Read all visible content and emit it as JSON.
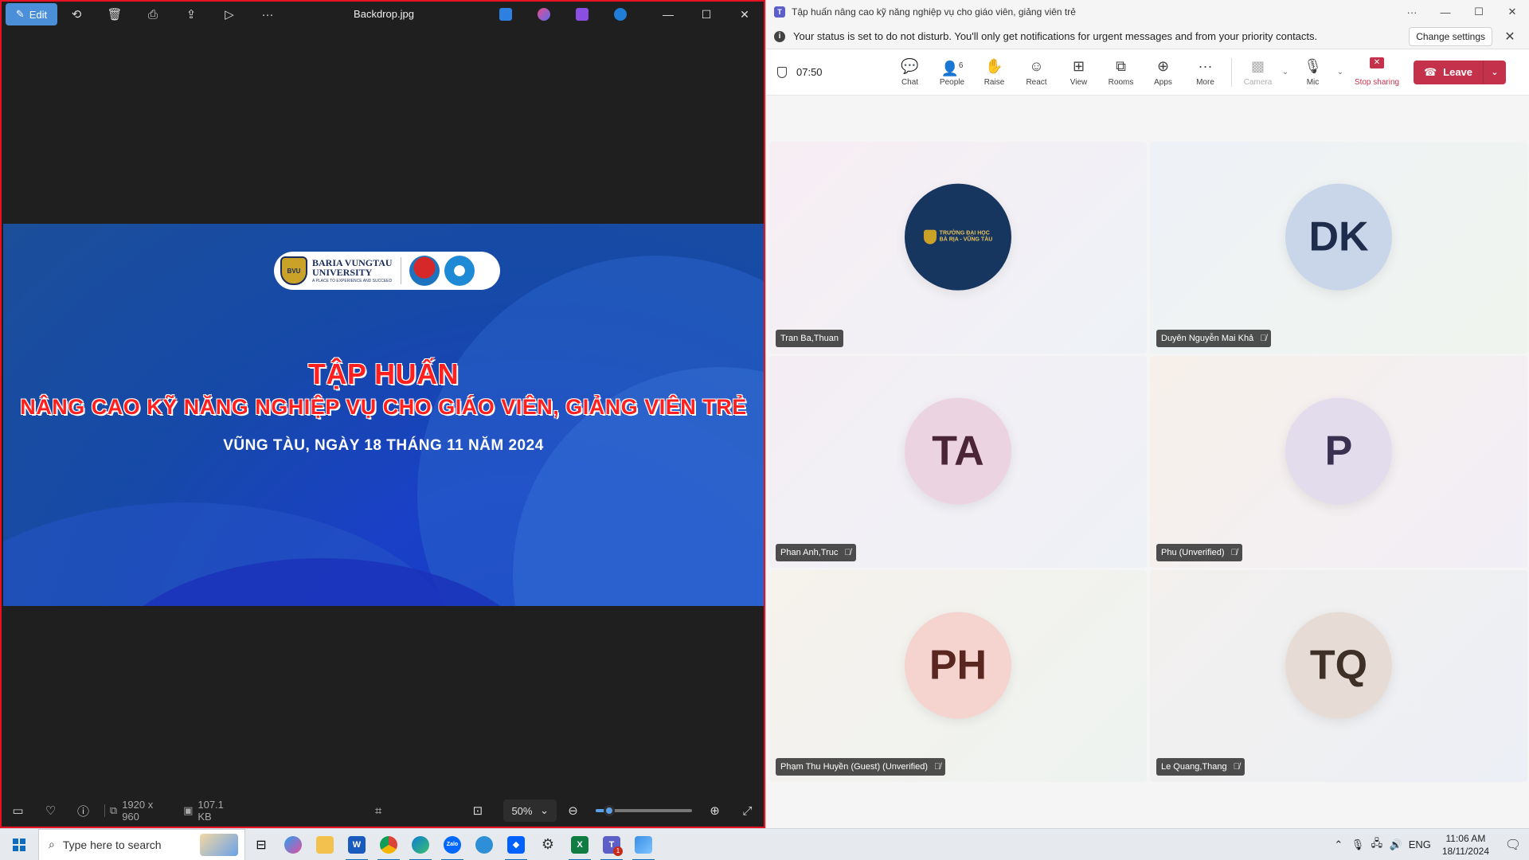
{
  "photos": {
    "edit_label": "Edit",
    "file_name": "Backdrop.jpg",
    "slide": {
      "uni_line1": "BARIA VUNGTAU",
      "uni_line2": "UNIVERSITY",
      "uni_tagline": "A PLACE TO EXPERIENCE AND SUCCEED",
      "shield_text": "BVU",
      "title": "TẬP HUẤN",
      "subtitle": "NÂNG CAO KỸ NĂNG NGHIỆP VỤ CHO GIÁO VIÊN, GIẢNG VIÊN TRẺ",
      "date_line": "VŨNG TÀU, NGÀY 18 THÁNG 11 NĂM 2024"
    },
    "status": {
      "dimensions": "1920 x 960",
      "file_size": "107.1 KB",
      "zoom": "50%",
      "zoom_fraction": 0.05
    }
  },
  "teams": {
    "window_title": "Tập huấn nâng cao kỹ năng nghiệp vụ cho giáo viên, giảng viên trẻ",
    "banner_text": "Your status is set to do not disturb. You'll only get notifications for urgent messages and from your priority contacts.",
    "change_settings": "Change settings",
    "timer": "07:50",
    "people_count": "6",
    "tools": {
      "chat": "Chat",
      "people": "People",
      "raise": "Raise",
      "react": "React",
      "view": "View",
      "rooms": "Rooms",
      "apps": "Apps",
      "more": "More",
      "camera": "Camera",
      "mic": "Mic",
      "stop_sharing": "Stop sharing",
      "leave": "Leave"
    },
    "participants": [
      {
        "name": "Tran Ba,Thuan",
        "initials": "",
        "muted": false,
        "avatar_bg": "#16355f",
        "logo_line1": "TRƯỜNG ĐẠI HỌC",
        "logo_line2": "BÀ RỊA - VŨNG TÀU"
      },
      {
        "name": "Duyên Nguyễn Mai Khả",
        "initials": "DK",
        "muted": true,
        "avatar_bg": "#c9d6ea",
        "text_color": "#1f2d4d"
      },
      {
        "name": "Phan Anh,Truc",
        "initials": "TA",
        "muted": true,
        "avatar_bg": "#ecd3e1",
        "text_color": "#4a2538"
      },
      {
        "name": "Phu (Unverified)",
        "initials": "P",
        "muted": true,
        "avatar_bg": "#e2dcec",
        "text_color": "#3a3050"
      },
      {
        "name": "Phạm Thu Huyền (Guest) (Unverified)",
        "initials": "PH",
        "muted": true,
        "avatar_bg": "#f5d4cf",
        "text_color": "#5a2620"
      },
      {
        "name": "Le Quang,Thang",
        "initials": "TQ",
        "muted": true,
        "avatar_bg": "#e7dcd5",
        "text_color": "#3e2f27"
      }
    ]
  },
  "taskbar": {
    "search_placeholder": "Type here to search",
    "language": "ENG",
    "time": "11:06 AM",
    "date": "18/11/2024",
    "teams_badge": "1",
    "zalo_label": "Zalo"
  }
}
